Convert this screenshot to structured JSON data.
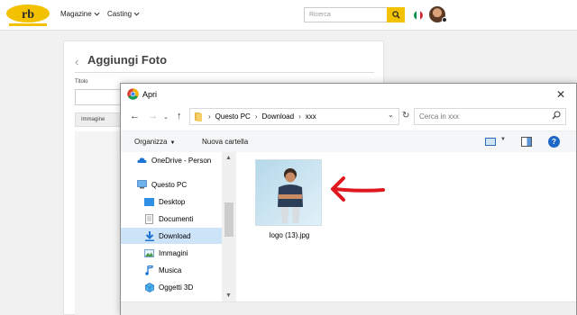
{
  "site": {
    "logo_alt": "logo",
    "nav": [
      {
        "label": "Magazine"
      },
      {
        "label": "Casting"
      }
    ],
    "search_placeholder": "Ricerca",
    "flag_colors": [
      "#009246",
      "#ffffff",
      "#ce2b37"
    ]
  },
  "page": {
    "back_icon": "chevron-left-icon",
    "title": "Aggiungi Foto",
    "titolo_label": "Titolo",
    "immagine_tab": "Immagine"
  },
  "dialog": {
    "title": "Apri",
    "breadcrumb": [
      "Questo PC",
      "Download",
      "xxx"
    ],
    "search_placeholder": "Cerca in xxx",
    "commands": {
      "organize": "Organizza",
      "new_folder": "Nuova cartella"
    },
    "sidebar": [
      {
        "label": "OneDrive - Person",
        "icon": "cloud-icon"
      },
      {
        "label": "Questo PC",
        "icon": "computer-icon"
      },
      {
        "label": "Desktop",
        "icon": "desktop-icon"
      },
      {
        "label": "Documenti",
        "icon": "document-icon"
      },
      {
        "label": "Download",
        "icon": "download-icon",
        "selected": true
      },
      {
        "label": "Immagini",
        "icon": "pictures-icon"
      },
      {
        "label": "Musica",
        "icon": "music-icon"
      },
      {
        "label": "Oggetti 3D",
        "icon": "cube-icon"
      }
    ],
    "files": [
      {
        "name": "logo (13).jpg"
      }
    ]
  },
  "colors": {
    "accent_yellow": "#f2c200",
    "selection_blue": "#cde3f8",
    "annotation_red": "#e0171f"
  }
}
